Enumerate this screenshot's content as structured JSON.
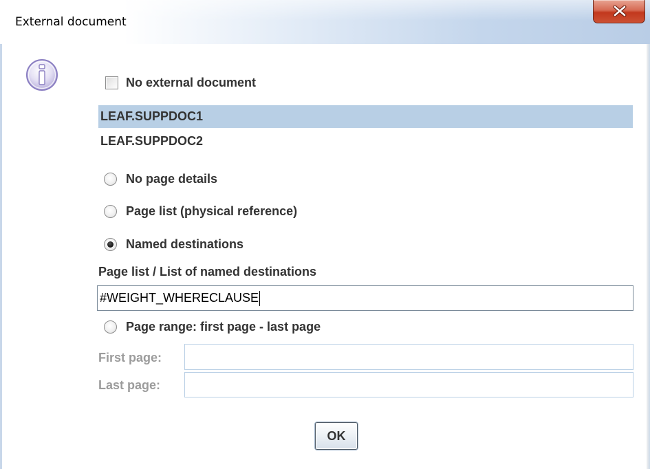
{
  "window": {
    "title": "External document",
    "close_icon": "close-x-icon"
  },
  "dialog": {
    "info_icon": "information-icon",
    "no_external_checkbox": {
      "label": "No external document",
      "checked": false
    },
    "documents": [
      {
        "label": "LEAF.SUPPDOC1",
        "selected": true
      },
      {
        "label": "LEAF.SUPPDOC2",
        "selected": false
      }
    ],
    "radio_options": {
      "no_page_details": {
        "label": "No page details",
        "selected": false
      },
      "page_list": {
        "label": "Page list (physical reference)",
        "selected": false
      },
      "named_destinations": {
        "label": "Named destinations",
        "selected": true
      }
    },
    "page_list_field": {
      "label": "Page list / List of named destinations",
      "value": "#WEIGHT_WHERECLAUSE"
    },
    "page_range": {
      "label": "Page range: first page - last page",
      "selected": false,
      "first_page_label": "First page:",
      "first_page_value": "",
      "last_page_label": "Last page:",
      "last_page_value": ""
    },
    "ok_label": "OK"
  },
  "colors": {
    "selection": "#b8cfe5",
    "close_button": "#c94a2e",
    "disabled_text": "#9c9c9c"
  }
}
